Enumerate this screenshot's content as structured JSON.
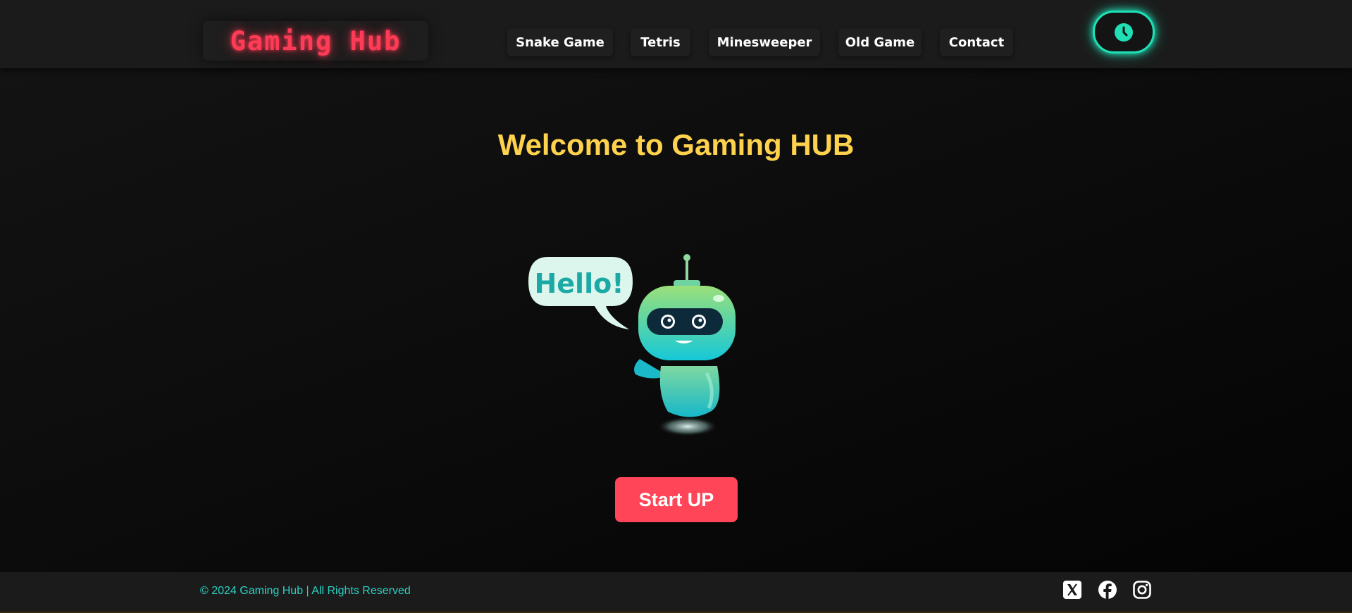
{
  "header": {
    "logo": "Gaming Hub",
    "nav": [
      {
        "label": "Snake Game"
      },
      {
        "label": "Tetris"
      },
      {
        "label": "Minesweeper"
      },
      {
        "label": "Old Game"
      },
      {
        "label": "Contact"
      }
    ],
    "theme_toggle_icon": "clock-icon"
  },
  "main": {
    "title": "Welcome to Gaming HUB",
    "robot_speech": "Hello!",
    "cta_label": "Start UP"
  },
  "footer": {
    "copyright": "© 2024 Gaming Hub | All Rights Reserved",
    "social_icons": [
      "x-twitter-icon",
      "facebook-icon",
      "instagram-icon"
    ]
  },
  "colors": {
    "logo": "#ff3b55",
    "accent_teal": "#1fe0b5",
    "title": "#ffd24d",
    "cta": "#ff4557",
    "footer_text": "#2bd0c3"
  }
}
